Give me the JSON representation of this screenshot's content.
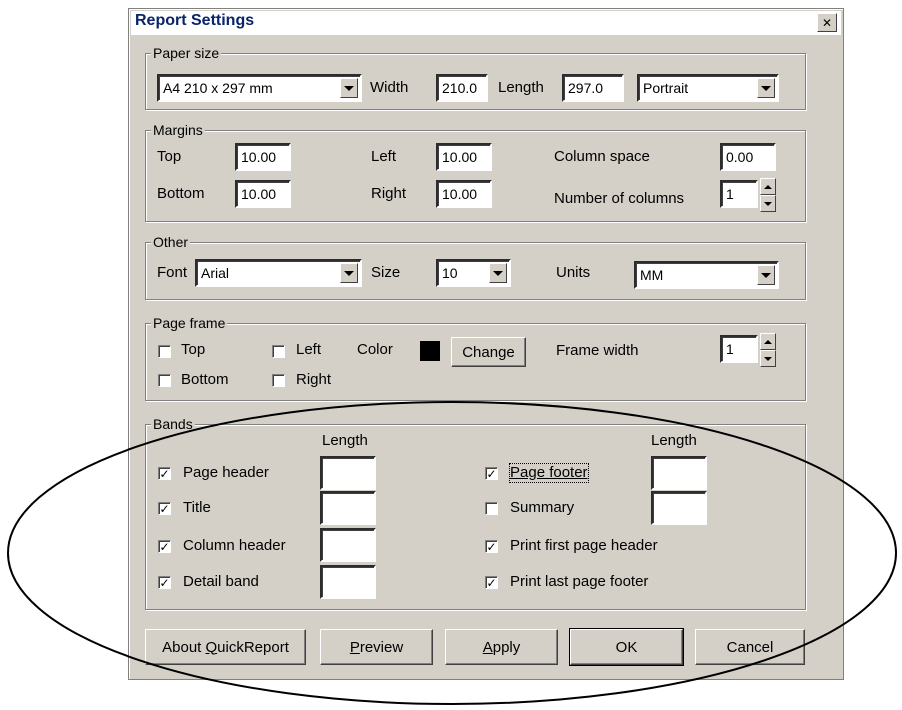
{
  "window": {
    "title": "Report Settings",
    "close_glyph": "✕"
  },
  "paper_size": {
    "legend": "Paper size",
    "size_value": "A4 210 x 297 mm",
    "width_label": "Width",
    "width_value": "210.0",
    "length_label": "Length",
    "length_value": "297.0",
    "orientation_value": "Portrait"
  },
  "margins": {
    "legend": "Margins",
    "top_label": "Top",
    "top_value": "10.00",
    "bottom_label": "Bottom",
    "bottom_value": "10.00",
    "left_label": "Left",
    "left_value": "10.00",
    "right_label": "Right",
    "right_value": "10.00",
    "column_space_label": "Column space",
    "column_space_value": "0.00",
    "columns_label": "Number of columns",
    "columns_value": "1"
  },
  "other": {
    "legend": "Other",
    "font_label": "Font",
    "font_value": "Arial",
    "size_label": "Size",
    "size_value": "10",
    "units_label": "Units",
    "units_value": "MM"
  },
  "page_frame": {
    "legend": "Page frame",
    "top_label": "Top",
    "top_checked": false,
    "bottom_label": "Bottom",
    "bottom_checked": false,
    "left_label": "Left",
    "left_checked": false,
    "right_label": "Right",
    "right_checked": false,
    "color_label": "Color",
    "color_value": "#000000",
    "change_label": "Change",
    "frame_width_label": "Frame width",
    "frame_width_value": "1"
  },
  "bands": {
    "legend": "Bands",
    "length_header_left": "Length",
    "length_header_right": "Length",
    "check_mark": "✓",
    "page_header_label": "Page header",
    "page_header_checked": true,
    "title_label": "Title",
    "title_checked": true,
    "column_header_label": "Column header",
    "column_header_checked": true,
    "detail_band_label": "Detail band",
    "detail_band_checked": true,
    "page_footer_label": "Page footer",
    "page_footer_checked": true,
    "summary_label": "Summary",
    "summary_checked": false,
    "print_first_label": "Print first page header",
    "print_first_checked": true,
    "print_last_label": "Print last page footer",
    "print_last_checked": true
  },
  "buttons": {
    "about_pre": "About ",
    "about_key": "Q",
    "about_post": "uickReport",
    "preview_key": "P",
    "preview_post": "review",
    "apply_key": "A",
    "apply_post": "pply",
    "ok": "OK",
    "cancel": "Cancel"
  },
  "annotation_color": "#000000"
}
